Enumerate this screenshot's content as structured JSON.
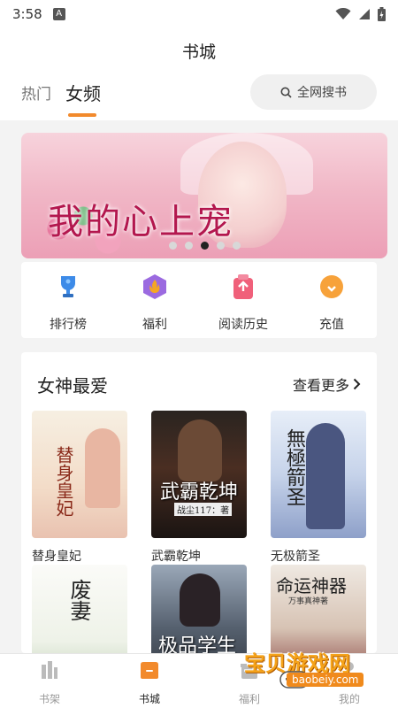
{
  "status_bar": {
    "time": "3:58",
    "app_badge": "A"
  },
  "header": {
    "title": "书城",
    "tabs": [
      {
        "label": "热门",
        "active": false
      },
      {
        "label": "女频",
        "active": true
      }
    ],
    "search_label": "全网搜书",
    "accent_color": "#f28a2c"
  },
  "banner": {
    "title": "我的心上宠",
    "dots_total": 5,
    "active_dot": 3
  },
  "quick_links": [
    {
      "label": "排行榜",
      "icon": "trophy-icon"
    },
    {
      "label": "福利",
      "icon": "gift-icon"
    },
    {
      "label": "阅读历史",
      "icon": "history-icon"
    },
    {
      "label": "充值",
      "icon": "recharge-icon"
    }
  ],
  "favorites": {
    "title": "女神最爱",
    "more_label": "查看更多",
    "books": [
      {
        "name": "替身皇妃",
        "cover_title": "替身皇妃"
      },
      {
        "name": "武霸乾坤",
        "cover_title": "武霸乾坤",
        "cover_author": "战尘117：著"
      },
      {
        "name": "无极箭圣",
        "cover_title": "無極箭圣"
      },
      {
        "name": "",
        "cover_title": "废妻"
      },
      {
        "name": "",
        "cover_title": "极品学生"
      },
      {
        "name": "",
        "cover_title": "命运神器",
        "cover_author": "万事真神著"
      }
    ]
  },
  "tabbar": {
    "items": [
      {
        "label": "书架",
        "icon": "bookshelf-icon",
        "active": false
      },
      {
        "label": "书城",
        "icon": "bookstore-icon",
        "active": true
      },
      {
        "label": "福利",
        "icon": "welfare-icon",
        "active": false
      },
      {
        "label": "我的",
        "icon": "profile-icon",
        "active": false
      }
    ]
  },
  "watermark": {
    "text": "宝贝游戏网",
    "url": "baobeiy.com"
  }
}
